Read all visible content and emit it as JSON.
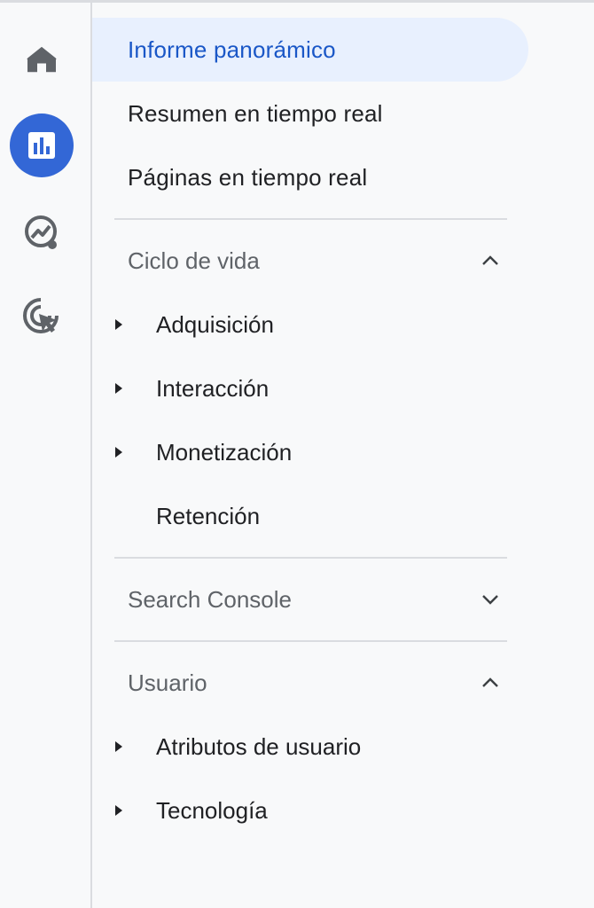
{
  "rail": {
    "items": [
      {
        "icon": "home-icon",
        "active": false
      },
      {
        "icon": "reports-bar-chart-icon",
        "active": true
      },
      {
        "icon": "explore-insights-icon",
        "active": false
      },
      {
        "icon": "advertising-target-icon",
        "active": false
      }
    ]
  },
  "nav": {
    "top_items": [
      {
        "label": "Informe panorámico",
        "selected": true
      },
      {
        "label": "Resumen en tiempo real",
        "selected": false
      },
      {
        "label": "Páginas en tiempo real",
        "selected": false
      }
    ],
    "sections": [
      {
        "title": "Ciclo de vida",
        "expanded": true,
        "items": [
          {
            "label": "Adquisición",
            "has_children": true
          },
          {
            "label": "Interacción",
            "has_children": true
          },
          {
            "label": "Monetización",
            "has_children": true
          },
          {
            "label": "Retención",
            "has_children": false
          }
        ]
      },
      {
        "title": "Search Console",
        "expanded": false,
        "items": []
      },
      {
        "title": "Usuario",
        "expanded": true,
        "items": [
          {
            "label": "Atributos de usuario",
            "has_children": true
          },
          {
            "label": "Tecnología",
            "has_children": true
          }
        ]
      }
    ]
  },
  "colors": {
    "accent": "#3367d6",
    "selected_bg": "#e8f0fe",
    "selected_text": "#1a57c7",
    "text": "#202124",
    "muted_text": "#5f6368",
    "divider": "#dadce0",
    "background": "#f8f9fa"
  }
}
